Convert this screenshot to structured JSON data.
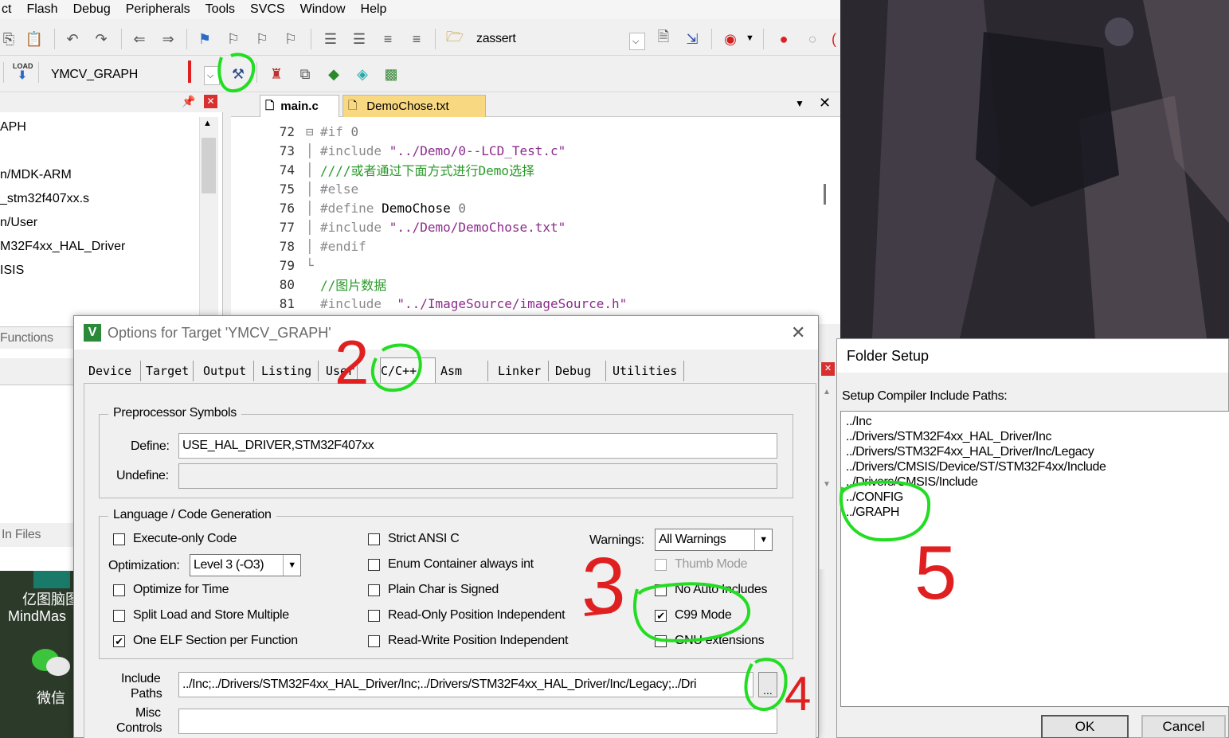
{
  "menu": [
    "ct",
    "Flash",
    "Debug",
    "Peripherals",
    "Tools",
    "SVCS",
    "Window",
    "Help"
  ],
  "toolbar1": {
    "find_text": "zassert"
  },
  "toolbar2": {
    "load_label": "LOAD",
    "target_name": "YMCV_GRAPH"
  },
  "project_panel": {
    "pin_icon": "pin-icon",
    "items": [
      "APH",
      "n/MDK-ARM",
      "_stm32f407xx.s",
      "n/User",
      "M32F4xx_HAL_Driver",
      "ISIS"
    ],
    "functions_tab": "Functions",
    "find_in_files_tab": "In Files"
  },
  "editor": {
    "tabs": [
      "main.c",
      "DemoChose.txt"
    ],
    "lines": [
      {
        "num": "72",
        "parts": [
          {
            "t": "#if ",
            "c": "pp"
          },
          {
            "t": "0",
            "c": "zero"
          }
        ]
      },
      {
        "num": "73",
        "parts": [
          {
            "t": "#include ",
            "c": "pp"
          },
          {
            "t": "\"../Demo/0--LCD_Test.c\"",
            "c": "str"
          }
        ]
      },
      {
        "num": "74",
        "parts": [
          {
            "t": "////或者通过下面方式进行Demo选择",
            "c": "cmt"
          }
        ]
      },
      {
        "num": "75",
        "parts": [
          {
            "t": "#else",
            "c": "pp"
          }
        ]
      },
      {
        "num": "76",
        "parts": [
          {
            "t": "#define ",
            "c": "pp"
          },
          {
            "t": "DemoChose ",
            "c": "plain"
          },
          {
            "t": "0",
            "c": "zero"
          }
        ]
      },
      {
        "num": "77",
        "parts": [
          {
            "t": "#include ",
            "c": "pp"
          },
          {
            "t": "\"../Demo/DemoChose.txt\"",
            "c": "str"
          }
        ]
      },
      {
        "num": "78",
        "parts": [
          {
            "t": "#endif",
            "c": "pp"
          }
        ]
      },
      {
        "num": "79",
        "parts": []
      },
      {
        "num": "80",
        "parts": [
          {
            "t": "//图片数据",
            "c": "cmt"
          }
        ]
      },
      {
        "num": "81",
        "parts": [
          {
            "t": "#include  ",
            "c": "pp"
          },
          {
            "t": "\"../ImageSource/imageSource.h\"",
            "c": "str"
          }
        ]
      }
    ]
  },
  "options_dialog": {
    "title": "Options for Target 'YMCV_GRAPH'",
    "tabs": [
      "Device",
      "Target",
      "Output",
      "Listing",
      "User",
      "C/C++",
      "Asm",
      "Linker",
      "Debug",
      "Utilities"
    ],
    "preprocessor": {
      "group_label": "Preprocessor Symbols",
      "define_label": "Define:",
      "define_value": "USE_HAL_DRIVER,STM32F407xx",
      "undefine_label": "Undefine:",
      "undefine_value": ""
    },
    "language": {
      "group_label": "Language / Code Generation",
      "execute_only": "Execute-only Code",
      "optimization_label": "Optimization:",
      "optimization_value": "Level 3 (-O3)",
      "optimize_time": "Optimize for Time",
      "split_load": "Split Load and Store Multiple",
      "one_elf": "One ELF Section per Function",
      "strict_ansi": "Strict ANSI C",
      "enum_container": "Enum Container always int",
      "plain_char": "Plain Char is Signed",
      "ro_pi": "Read-Only Position Independent",
      "rw_pi": "Read-Write Position Independent",
      "warnings_label": "Warnings:",
      "warnings_value": "All Warnings",
      "thumb_mode": "Thumb Mode",
      "no_auto_includes": "No Auto Includes",
      "c99_mode": "C99 Mode",
      "gnu_ext": "GNU extensions"
    },
    "include_paths_label1": "Include",
    "include_paths_label2": "Paths",
    "include_paths_value": "../Inc;../Drivers/STM32F4xx_HAL_Driver/Inc;../Drivers/STM32F4xx_HAL_Driver/Inc/Legacy;../Dri",
    "browse_label": "...",
    "misc_label1": "Misc",
    "misc_label2": "Controls"
  },
  "folder_setup": {
    "title": "Folder Setup",
    "subtitle": "Setup Compiler Include Paths:",
    "paths": [
      "../Inc",
      "../Drivers/STM32F4xx_HAL_Driver/Inc",
      "../Drivers/STM32F4xx_HAL_Driver/Inc/Legacy",
      "../Drivers/CMSIS/Device/ST/STM32F4xx/Include",
      "../Drivers/CMSIS/Include",
      "../CONFIG",
      "../GRAPH"
    ],
    "ok_label": "OK",
    "cancel_label": "Cancel"
  },
  "desktop": {
    "app1_line1": "亿图脑图",
    "app1_line2": "MindMas",
    "app2": "微信"
  },
  "annotations": {
    "n2": "2",
    "n3": "3",
    "n4": "4",
    "n5": "5"
  },
  "colors": {
    "annotation_green": "#22dd22",
    "annotation_red": "#e02020",
    "string_purple": "#8b2c8b",
    "comment_green": "#2a9a2a"
  }
}
